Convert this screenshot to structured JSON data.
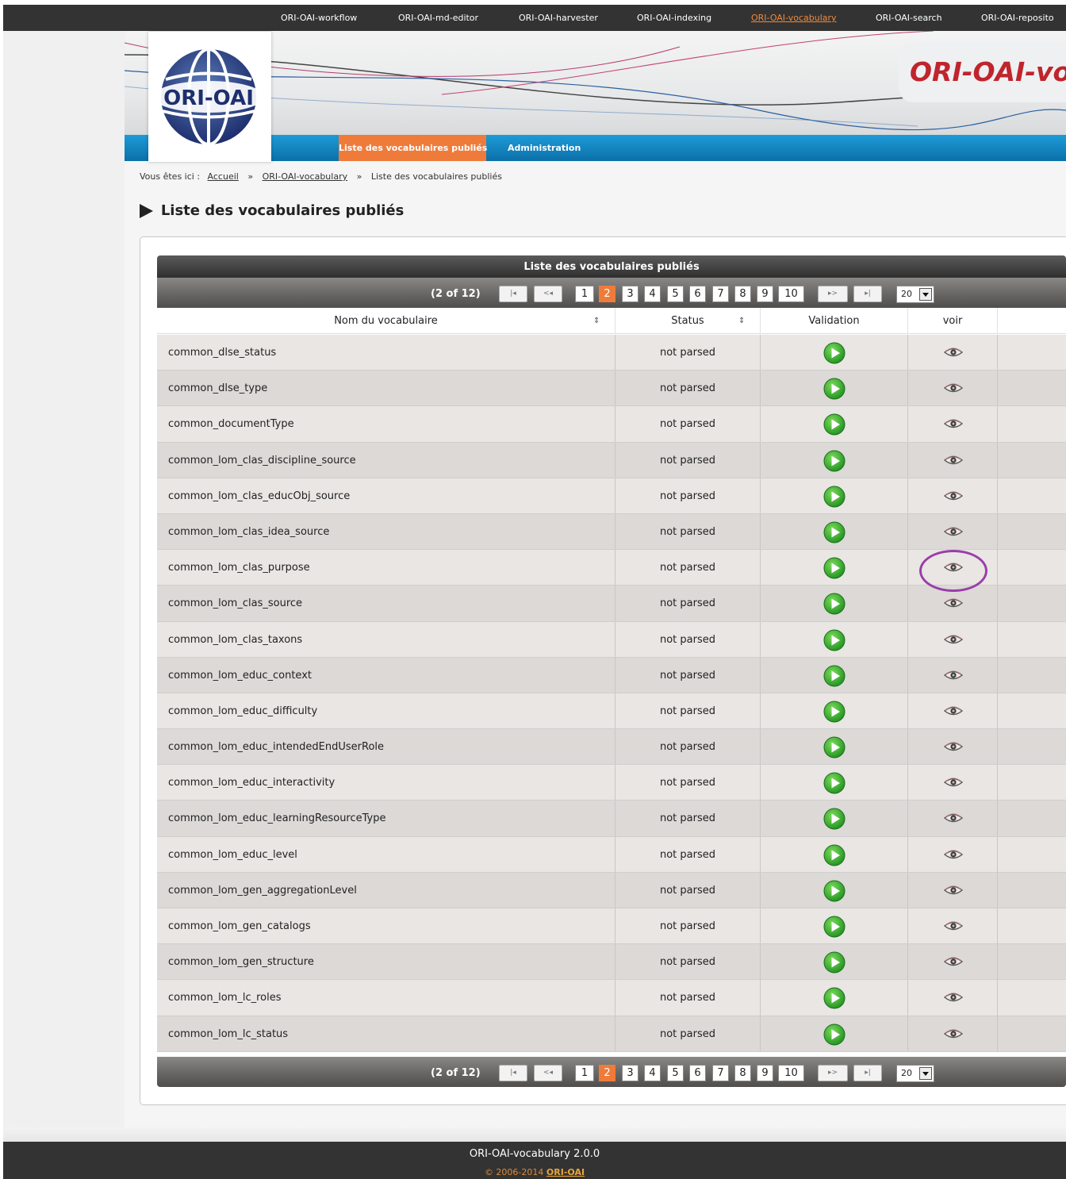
{
  "topnav": {
    "items": [
      "ORI-OAI-workflow",
      "ORI-OAI-md-editor",
      "ORI-OAI-harvester",
      "ORI-OAI-indexing",
      "ORI-OAI-vocabulary",
      "ORI-OAI-search",
      "ORI-OAI-reposito"
    ],
    "active": "ORI-OAI-vocabulary"
  },
  "banner": {
    "logo_text": "ORI-OAI",
    "brand_text": "ORI-OAI-vo"
  },
  "tabs": {
    "liste": "Liste des vocabulaires publiés",
    "admin": "Administration"
  },
  "breadcrumb": {
    "prefix": "Vous êtes ici :",
    "home": "Accueil",
    "section": "ORI-OAI-vocabulary",
    "current": "Liste des vocabulaires publiés",
    "separator": "»"
  },
  "page_title": "Liste des vocabulaires publiés",
  "table": {
    "caption": "Liste des vocabulaires publiés",
    "pager": {
      "count": "(2 of 12)",
      "first": "|◂",
      "prev": "<◂",
      "next": "▸>",
      "last": "▸|",
      "pages": [
        "1",
        "2",
        "3",
        "4",
        "5",
        "6",
        "7",
        "8",
        "9",
        "10"
      ],
      "current_page": "2",
      "rows_per_page": "20"
    },
    "columns": {
      "name": "Nom du vocabulaire",
      "status": "Status",
      "validation": "Validation",
      "voir": "voir"
    },
    "rows": [
      {
        "name": "common_dlse_status",
        "status": "not parsed"
      },
      {
        "name": "common_dlse_type",
        "status": "not parsed"
      },
      {
        "name": "common_documentType",
        "status": "not parsed"
      },
      {
        "name": "common_lom_clas_discipline_source",
        "status": "not parsed"
      },
      {
        "name": "common_lom_clas_educObj_source",
        "status": "not parsed"
      },
      {
        "name": "common_lom_clas_idea_source",
        "status": "not parsed"
      },
      {
        "name": "common_lom_clas_purpose",
        "status": "not parsed"
      },
      {
        "name": "common_lom_clas_source",
        "status": "not parsed"
      },
      {
        "name": "common_lom_clas_taxons",
        "status": "not parsed"
      },
      {
        "name": "common_lom_educ_context",
        "status": "not parsed"
      },
      {
        "name": "common_lom_educ_difficulty",
        "status": "not parsed"
      },
      {
        "name": "common_lom_educ_intendedEndUserRole",
        "status": "not parsed"
      },
      {
        "name": "common_lom_educ_interactivity",
        "status": "not parsed"
      },
      {
        "name": "common_lom_educ_learningResourceType",
        "status": "not parsed"
      },
      {
        "name": "common_lom_educ_level",
        "status": "not parsed"
      },
      {
        "name": "common_lom_gen_aggregationLevel",
        "status": "not parsed"
      },
      {
        "name": "common_lom_gen_catalogs",
        "status": "not parsed"
      },
      {
        "name": "common_lom_gen_structure",
        "status": "not parsed"
      },
      {
        "name": "common_lom_lc_roles",
        "status": "not parsed"
      },
      {
        "name": "common_lom_lc_status",
        "status": "not parsed"
      }
    ],
    "highlighted_row": "common_lom_clas_purpose"
  },
  "footer": {
    "version": "ORI-OAI-vocabulary 2.0.0",
    "copyright": "© 2006-2014",
    "link": "ORI-OAI"
  },
  "colors": {
    "accent": "#ef7b3b",
    "nav_bg": "#333333",
    "blue_bar": "#0c6fa8",
    "brand": "#c0242c",
    "highlight_ring": "#9b3ea8",
    "play_green": "#2ea12e"
  },
  "icons": {
    "validation": "play-circle-icon",
    "voir": "eye-icon",
    "title": "triangle-right-icon"
  }
}
